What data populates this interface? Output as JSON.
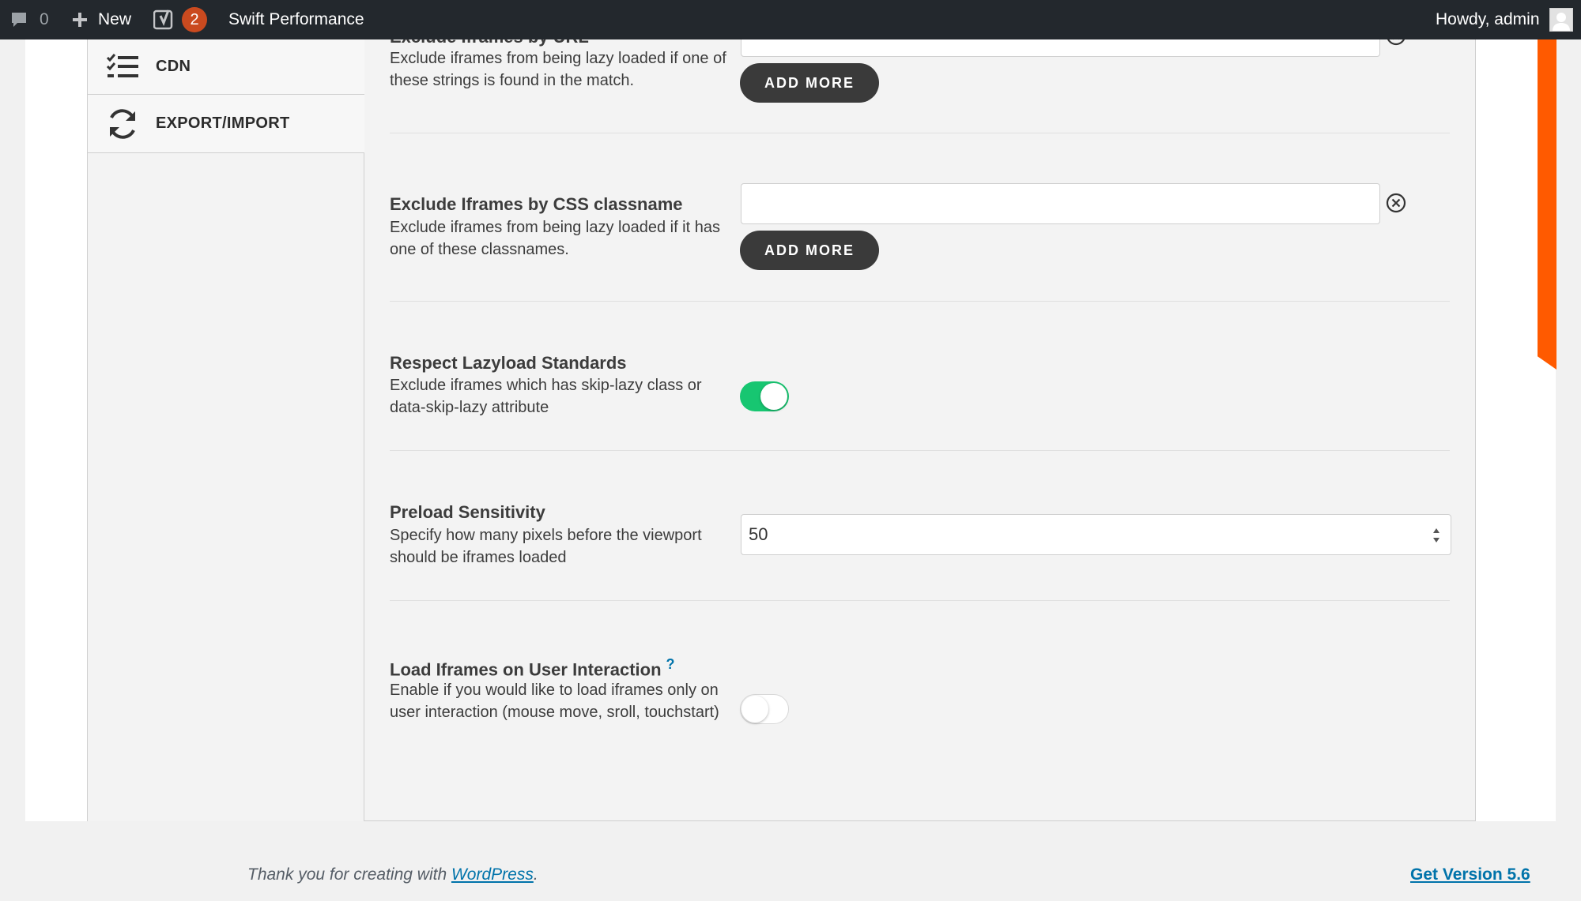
{
  "adminbar": {
    "comments_count": "0",
    "new_label": "New",
    "yoast_badge": "2",
    "site_name": "Swift Performance",
    "greeting": "Howdy, admin"
  },
  "sidebar": {
    "items": [
      {
        "label": "CDN",
        "icon": "checklist-icon"
      },
      {
        "label": "EXPORT/IMPORT",
        "icon": "refresh-icon"
      }
    ]
  },
  "settings": {
    "exclude_url": {
      "title": "Exclude Iframes by URL",
      "description": "Exclude iframes from being lazy loaded if one of these strings is found in the match.",
      "value": "",
      "button": "ADD MORE"
    },
    "exclude_css": {
      "title": "Exclude Iframes by CSS classname",
      "description": "Exclude iframes from being lazy loaded if it has one of these classnames.",
      "value": "",
      "button": "ADD MORE"
    },
    "respect_lazyload": {
      "title": "Respect Lazyload Standards",
      "description": "Exclude iframes which has skip-lazy class or data-skip-lazy attribute",
      "enabled": true
    },
    "preload_sensitivity": {
      "title": "Preload Sensitivity",
      "description": "Specify how many pixels before the viewport should be iframes loaded",
      "value": "50"
    },
    "load_on_interaction": {
      "title": "Load Iframes on User Interaction",
      "help": "?",
      "description": "Enable if you would like to load iframes only on user interaction (mouse move, sroll, touchstart)",
      "enabled": false
    }
  },
  "footer": {
    "thanks_prefix": "Thank you for creating with ",
    "wordpress_link": "WordPress",
    "thanks_suffix": ".",
    "version_link": "Get Version 5.6"
  },
  "colors": {
    "adminbar_bg": "#23282d",
    "badge": "#ca4a1f",
    "toggle_on": "#17c671",
    "button_bg": "#3a3a3a",
    "accent_strip": "#ff5a00",
    "link": "#0073aa"
  }
}
